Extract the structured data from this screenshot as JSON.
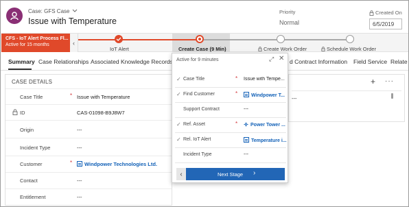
{
  "header": {
    "entity_label": "Case: GFS Case",
    "title": "Issue with Temperature",
    "priority_label": "Priority",
    "priority_value": "Normal",
    "created_on_label": "Created On",
    "created_on_value": "6/5/2019"
  },
  "process": {
    "name": "CFS - IoT Alert Process Fl...",
    "active_for": "Active for 15 months",
    "stages": [
      {
        "label": "IoT Alert",
        "state": "completed"
      },
      {
        "label": "Create Case  (9 Min)",
        "state": "active"
      },
      {
        "label": "Create Work Order",
        "state": "locked"
      },
      {
        "label": "Schedule Work Order",
        "state": "locked"
      }
    ]
  },
  "tabs": [
    {
      "label": "Summary",
      "active": true
    },
    {
      "label": "Case Relationships"
    },
    {
      "label": "Associated Knowledge Records"
    },
    {
      "label": "d Contract Information"
    },
    {
      "label": "Field Service"
    },
    {
      "label": "Relate"
    }
  ],
  "case_details": {
    "section_title": "CASE DETAILS",
    "rows": [
      {
        "label": "Case Title",
        "required": "*",
        "value": "Issue with Temperature"
      },
      {
        "label": "ID",
        "value": "CAS-01098-B9J8W7"
      },
      {
        "label": "Origin",
        "value": "---"
      },
      {
        "label": "Incident Type",
        "value": "---"
      },
      {
        "label": "Customer",
        "required": "*",
        "value": "Windpower Technologies Ltd."
      },
      {
        "label": "Contact",
        "value": "---"
      },
      {
        "label": "Entitlement",
        "value": "---"
      }
    ]
  },
  "flyout": {
    "header": "Active for 9 minutes",
    "rows": [
      {
        "label": "Case Title",
        "required": "*",
        "value": "Issue with Tempe..."
      },
      {
        "label": "Find Customer",
        "required": "*",
        "value": "Windpower T..."
      },
      {
        "label": "Support Contract",
        "value": "---"
      },
      {
        "label": "Ref. Asset",
        "required": "*",
        "value": "Power Tower ..."
      },
      {
        "label": "Rel. IoT Alert",
        "value": "Temperature i..."
      },
      {
        "label": "Incident Type",
        "value": "---"
      }
    ],
    "next_stage_label": "Next Stage"
  },
  "right_panel": {
    "plus": "+",
    "more": "···",
    "value": "---"
  },
  "colors": {
    "process_flag": "#e0492a",
    "stage_completed": "#e0492a",
    "stage_locked": "#9b9b9b",
    "link": "#1160b7",
    "primary_button": "#2266b6",
    "avatar": "#8a2f75"
  }
}
